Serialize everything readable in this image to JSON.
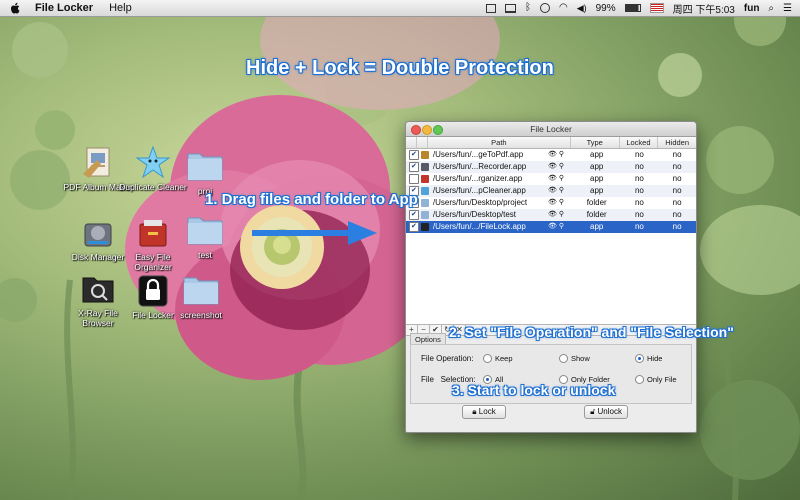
{
  "menubar": {
    "app_name": "File Locker",
    "menu_help": "Help",
    "battery": "99%",
    "datetime": "周四 下午5:03",
    "user": "fun"
  },
  "headline": "Hide + Lock = Double Protection",
  "callouts": {
    "step1": "1. Drag files and folder to App",
    "step2": "2. Set \"File Operation\" and \"File Selection\"",
    "step3": "3. Start to lock or unlock"
  },
  "desktop_icons": [
    {
      "label": "PDF Album Maker"
    },
    {
      "label": "Duplicate Cleaner"
    },
    {
      "label": "proj"
    },
    {
      "label": "Disk Manager"
    },
    {
      "label": "Easy File Organizer"
    },
    {
      "label": "test"
    },
    {
      "label": "X-Ray File Browser"
    },
    {
      "label": "File Locker"
    },
    {
      "label": "screenshot"
    }
  ],
  "window": {
    "title": "File Locker",
    "columns": {
      "path": "Path",
      "type": "Type",
      "locked": "Locked",
      "hidden": "Hidden"
    },
    "rows": [
      {
        "path": "/Users/fun/...geToPdf.app",
        "type": "app",
        "locked": "no",
        "hidden": "no",
        "checked": true,
        "icon_color": "#b8862b"
      },
      {
        "path": "/Users/fun/...Recorder.app",
        "type": "app",
        "locked": "no",
        "hidden": "no",
        "checked": true,
        "icon_color": "#555a66"
      },
      {
        "path": "/Users/fun/...rganizer.app",
        "type": "app",
        "locked": "no",
        "hidden": "no",
        "checked": false,
        "icon_color": "#c0342a"
      },
      {
        "path": "/Users/fun/...pCleaner.app",
        "type": "app",
        "locked": "no",
        "hidden": "no",
        "checked": true,
        "icon_color": "#4fa3d8"
      },
      {
        "path": "/Users/fun/Desktop/project",
        "type": "folder",
        "locked": "no",
        "hidden": "no",
        "checked": true,
        "icon_color": "#8fb2d6"
      },
      {
        "path": "/Users/fun/Desktop/test",
        "type": "folder",
        "locked": "no",
        "hidden": "no",
        "checked": true,
        "icon_color": "#8fb2d6"
      },
      {
        "path": "/Users/fun/.../FileLock.app",
        "type": "app",
        "locked": "no",
        "hidden": "no",
        "checked": true,
        "icon_color": "#222222",
        "selected": true
      }
    ],
    "toolbar": [
      "+",
      "−",
      "✔",
      "↻",
      "✕"
    ],
    "options_tab": "Options",
    "file_operation_label": "File Operation:",
    "file_operation_options": [
      {
        "label": "Keep",
        "selected": false
      },
      {
        "label": "Show",
        "selected": false
      },
      {
        "label": "Hide",
        "selected": true
      }
    ],
    "file_selection_label": "File",
    "file_selection_label2": "Selection:",
    "file_selection_options": [
      {
        "label": "All",
        "selected": true
      },
      {
        "label": "Only Folder",
        "selected": false
      },
      {
        "label": "Only File",
        "selected": false
      }
    ],
    "lock_button": "Lock",
    "unlock_button": "Unlock"
  },
  "colors": {
    "selection": "#2a64c6",
    "callout_outline": "#1e6fd0",
    "arrow": "#2b7fe0"
  }
}
